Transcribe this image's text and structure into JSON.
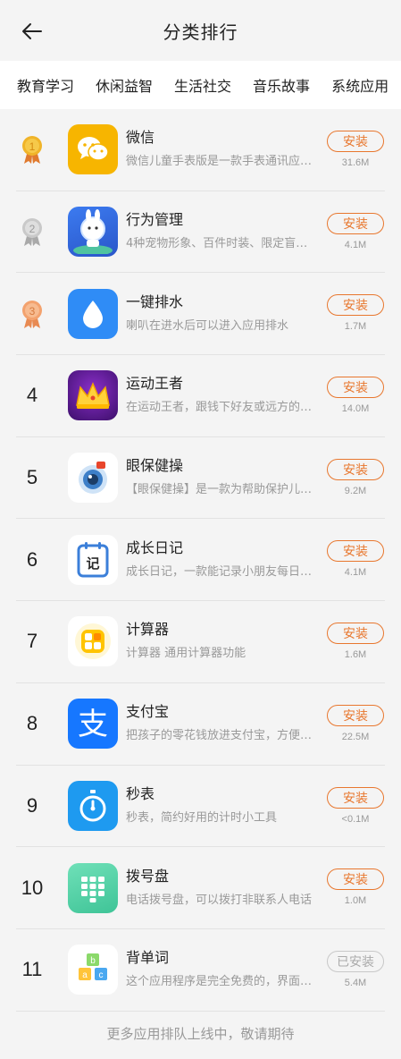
{
  "header": {
    "title": "分类排行",
    "back_icon": "arrow-left-icon"
  },
  "tabs": [
    {
      "label": "教育学习"
    },
    {
      "label": "休闲益智"
    },
    {
      "label": "生活社交"
    },
    {
      "label": "音乐故事"
    },
    {
      "label": "系统应用"
    }
  ],
  "apps": [
    {
      "rank": "1",
      "medal": "gold",
      "name": "微信",
      "desc": "微信儿童手表版是一款手表通讯应…",
      "button": "安装",
      "installed": false,
      "size": "31.6M",
      "icon": "wechat-icon"
    },
    {
      "rank": "2",
      "medal": "silver",
      "name": "行为管理",
      "desc": "4种宠物形象、百件时装、限定盲…",
      "button": "安装",
      "installed": false,
      "size": "4.1M",
      "icon": "astronaut-rabbit-icon"
    },
    {
      "rank": "3",
      "medal": "bronze",
      "name": "一键排水",
      "desc": "喇叭在进水后可以进入应用排水",
      "button": "安装",
      "installed": false,
      "size": "1.7M",
      "icon": "water-drop-icon"
    },
    {
      "rank": "4",
      "name": "运动王者",
      "desc": "在运动王者，跟钱下好友或远方的…",
      "button": "安装",
      "installed": false,
      "size": "14.0M",
      "icon": "crown-icon"
    },
    {
      "rank": "5",
      "name": "眼保健操",
      "desc": "【眼保健操】是一款为帮助保护儿…",
      "button": "安装",
      "installed": false,
      "size": "9.2M",
      "icon": "eye-icon"
    },
    {
      "rank": "6",
      "name": "成长日记",
      "desc": "成长日记，一款能记录小朋友每日…",
      "button": "安装",
      "installed": false,
      "size": "4.1M",
      "icon": "diary-icon"
    },
    {
      "rank": "7",
      "name": "计算器",
      "desc": "计算器 通用计算器功能",
      "button": "安装",
      "installed": false,
      "size": "1.6M",
      "icon": "calculator-icon"
    },
    {
      "rank": "8",
      "name": "支付宝",
      "desc": "把孩子的零花钱放进支付宝，方便…",
      "button": "安装",
      "installed": false,
      "size": "22.5M",
      "icon": "alipay-icon"
    },
    {
      "rank": "9",
      "name": "秒表",
      "desc": "秒表，简约好用的计时小工具",
      "button": "安装",
      "installed": false,
      "size": "<0.1M",
      "icon": "stopwatch-icon"
    },
    {
      "rank": "10",
      "name": "拨号盘",
      "desc": "电话拨号盘，可以拨打非联系人电话",
      "button": "安装",
      "installed": false,
      "size": "1.0M",
      "icon": "dialpad-icon"
    },
    {
      "rank": "11",
      "name": "背单词",
      "desc": "这个应用程序是完全免费的，界面…",
      "button": "已安装",
      "installed": true,
      "size": "5.4M",
      "icon": "abc-blocks-icon"
    }
  ],
  "footer": {
    "text": "更多应用排队上线中，敬请期待"
  },
  "colors": {
    "accent": "#e8772e",
    "gold": "#f0b429",
    "silver": "#c9c9c9",
    "bronze": "#f3a26e"
  }
}
